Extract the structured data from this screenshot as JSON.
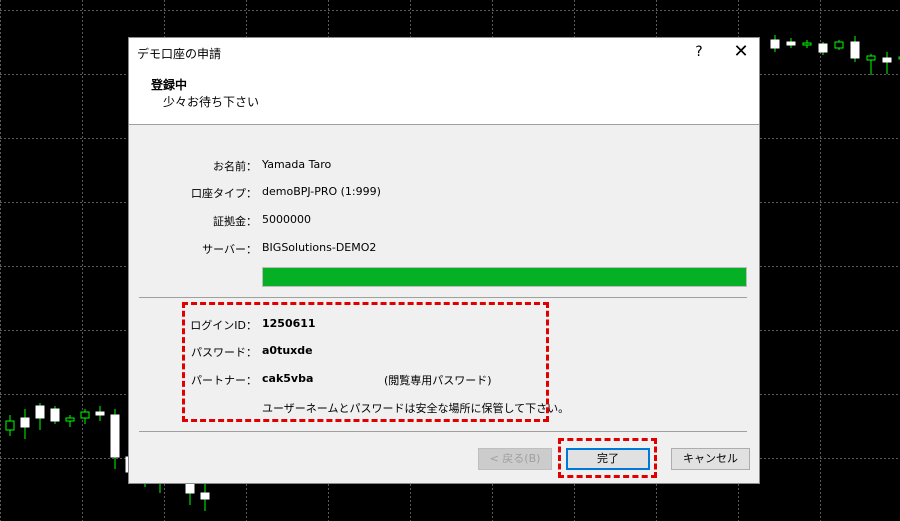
{
  "dialog": {
    "title": "デモ口座の申請",
    "help_label": "?",
    "close_label": "✕",
    "header_title": "登録中",
    "header_subtitle": "少々お待ち下さい"
  },
  "account": {
    "name_label": "お名前：",
    "name_value": "Yamada Taro",
    "type_label": "口座タイプ：",
    "type_value": "demoBPJ-PRO (1:999)",
    "deposit_label": "証拠金：",
    "deposit_value": "5000000",
    "server_label": "サーバー：",
    "server_value": "BIGSolutions-DEMO2"
  },
  "progress": {
    "percent": 100,
    "color": "#06b025"
  },
  "credentials": {
    "login_label": "ログインID：",
    "login_value": "1250611",
    "password_label": "パスワード：",
    "password_value": "a0tuxde",
    "partner_label": "パートナー：",
    "partner_value": "cak5vba",
    "partner_note": "(閲覧専用パスワード)",
    "notice": "ユーザーネームとパスワードは安全な場所に保管して下さい。"
  },
  "buttons": {
    "back_label": "< 戻る(B)",
    "finish_label": "完了",
    "cancel_label": "キャンセル"
  },
  "colors": {
    "chart_bg": "#000000",
    "grid": "#5a5a5a",
    "candle_up_fill": "#ffffff",
    "wick": "#00ff00",
    "annotation": "#e00000"
  },
  "chart_data": {
    "type": "candlestick",
    "candles_right": [
      {
        "o": 60,
        "h": 65,
        "l": 48,
        "c": 52,
        "up": true
      },
      {
        "o": 58,
        "h": 62,
        "l": 52,
        "c": 55,
        "up": true
      },
      {
        "o": 57,
        "h": 60,
        "l": 52,
        "c": 56,
        "up": false
      },
      {
        "o": 56,
        "h": 58,
        "l": 45,
        "c": 48,
        "up": true
      },
      {
        "o": 58,
        "h": 60,
        "l": 50,
        "c": 52,
        "up": false
      },
      {
        "o": 58,
        "h": 64,
        "l": 38,
        "c": 42,
        "up": true
      },
      {
        "o": 44,
        "h": 46,
        "l": 25,
        "c": 40,
        "up": false
      },
      {
        "o": 42,
        "h": 48,
        "l": 26,
        "c": 38,
        "up": true
      },
      {
        "o": 42,
        "h": 46,
        "l": 34,
        "c": 43,
        "up": false
      }
    ],
    "candles_left": [
      {
        "o": 8,
        "h": 10,
        "l": 3,
        "c": 5,
        "up": false
      },
      {
        "o": 6,
        "h": 12,
        "l": 2,
        "c": 9,
        "up": true
      },
      {
        "o": 9,
        "h": 14,
        "l": 5,
        "c": 13,
        "up": true
      },
      {
        "o": 12,
        "h": 13,
        "l": 7,
        "c": 8,
        "up": true
      },
      {
        "o": 8,
        "h": 10,
        "l": 6,
        "c": 9,
        "up": false
      },
      {
        "o": 9,
        "h": 12,
        "l": 7,
        "c": 11,
        "up": false
      },
      {
        "o": 11,
        "h": 13,
        "l": 8,
        "c": 10,
        "up": true
      },
      {
        "o": 10,
        "h": 12,
        "l": -8,
        "c": -4,
        "up": true
      },
      {
        "o": -4,
        "h": -1,
        "l": -12,
        "c": -9,
        "up": true
      },
      {
        "o": -9,
        "h": -6,
        "l": -14,
        "c": -12,
        "up": true
      },
      {
        "o": -12,
        "h": -6,
        "l": -16,
        "c": -8,
        "up": false
      },
      {
        "o": -8,
        "h": -6,
        "l": -12,
        "c": -10,
        "up": false
      },
      {
        "o": -10,
        "h": -6,
        "l": -20,
        "c": -16,
        "up": true
      },
      {
        "o": -16,
        "h": -12,
        "l": -22,
        "c": -18,
        "up": true
      }
    ]
  }
}
